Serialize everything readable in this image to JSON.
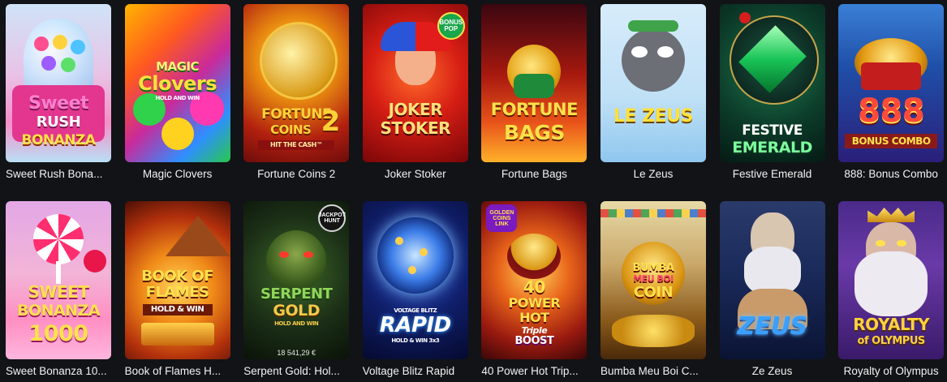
{
  "games": [
    {
      "title": "Sweet Rush Bona...",
      "art": [
        "Sweet",
        "RUSH",
        "BONANZA"
      ]
    },
    {
      "title": "Magic Clovers",
      "art": [
        "MAGIC",
        "Clovers",
        "HOLD AND WIN"
      ]
    },
    {
      "title": "Fortune Coins 2",
      "art": [
        "FORTUNE",
        "COINS",
        "2",
        "HIT THE CASH™"
      ]
    },
    {
      "title": "Joker Stoker",
      "art": [
        "JOKER",
        "STOKER"
      ],
      "badge": "BONUS POP"
    },
    {
      "title": "Fortune Bags",
      "art": [
        "FORTUNE",
        "BAGS"
      ]
    },
    {
      "title": "Le Zeus",
      "art": [
        "LE ZEUS"
      ]
    },
    {
      "title": "Festive Emerald",
      "art": [
        "FESTIVE",
        "EMERALD"
      ]
    },
    {
      "title": "888: Bonus Combo",
      "art": [
        "888",
        "BONUS COMBO"
      ]
    },
    {
      "title": "Sweet Bonanza 10...",
      "art": [
        "SWEET",
        "BONANZA",
        "1000"
      ]
    },
    {
      "title": "Book of Flames H...",
      "art": [
        "BOOK OF",
        "FLAMES",
        "HOLD & WIN"
      ]
    },
    {
      "title": "Serpent Gold: Hol...",
      "art": [
        "SERPENT",
        "GOLD",
        "HOLD AND WIN"
      ],
      "badge": "JACKPOT HUNT",
      "amount": "18 541,29 €"
    },
    {
      "title": "Voltage Blitz Rapid",
      "art": [
        "VOLTAGE BLITZ",
        "RAPID",
        "HOLD & WIN 3x3"
      ]
    },
    {
      "title": "40 Power Hot Trip...",
      "art": [
        "40",
        "POWER",
        "HOT",
        "Triple",
        "BOOST"
      ],
      "badge": "GOLDEN COINS LINK"
    },
    {
      "title": "Bumba Meu Boi C...",
      "art": [
        "BUMBA",
        "MEU BOI",
        "COIN"
      ]
    },
    {
      "title": "Ze Zeus",
      "art": [
        "ZEUS"
      ]
    },
    {
      "title": "Royalty of Olympus",
      "art": [
        "ROYALTY",
        "of OLYMPUS"
      ]
    }
  ],
  "colors": {
    "page_bg": "#121316",
    "title_text": "#f2f2f2"
  }
}
